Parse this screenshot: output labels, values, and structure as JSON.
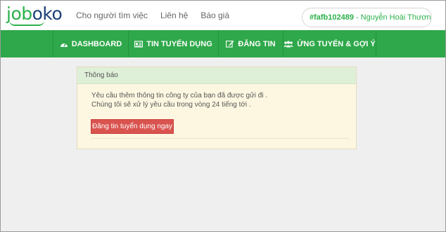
{
  "logo": {
    "text": "joboko"
  },
  "topnav": {
    "items": [
      "Cho người tìm việc",
      "Liên hệ",
      "Báo giá"
    ]
  },
  "user": {
    "id": "#fafb102489",
    "separator": "-",
    "name": "Nguyễn Hoài Thươn..."
  },
  "mainnav": {
    "items": [
      {
        "label": "DASHBOARD",
        "icon": "dashboard-icon"
      },
      {
        "label": "TIN TUYỂN DỤNG",
        "icon": "newspaper-icon"
      },
      {
        "label": "ĐĂNG TIN",
        "icon": "edit-icon"
      },
      {
        "label": "ỨNG TUYỂN & GỢI Ý",
        "icon": "users-icon"
      }
    ]
  },
  "notice": {
    "title": "Thông báo",
    "line1": "Yêu cầu thêm thông tin công ty của bạn đã được gửi đi .",
    "line2": "Chúng tôi sẽ xử lý yêu cầu trong vòng 24 tiếng tới .",
    "button": "Đăng tin tuyển dụng ngay"
  },
  "colors": {
    "brand_green": "#2ea84a",
    "notice_header": "#dff0d8",
    "notice_body": "#fdf7e1",
    "button_red": "#d9534f"
  }
}
